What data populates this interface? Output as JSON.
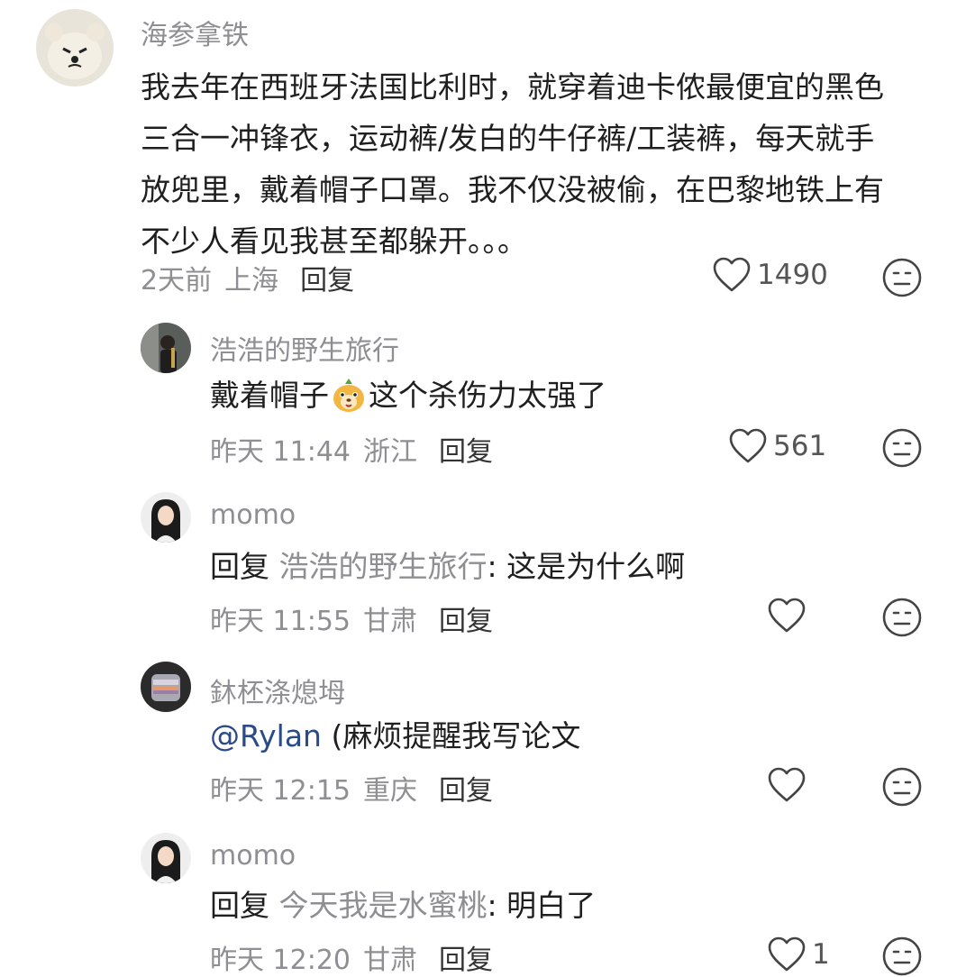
{
  "comments": [
    {
      "username": "海参拿铁",
      "text_lines": [
        "我去年在西班牙法国比利时，就穿着迪卡侬最便宜的黑色",
        "三合一冲锋衣，运动裤/发白的牛仔裤/工装裤，每天就手",
        "放兜里，戴着帽子口罩。我不仅没被偷，在巴黎地铁上有",
        "不少人看见我甚至都躲开。。。"
      ],
      "time": "2天前",
      "location": "上海",
      "reply_label": "回复",
      "likes": "1490"
    },
    {
      "username": "浩浩的野生旅行",
      "text_before": "戴着帽子",
      "text_after": "这个杀伤力太强了",
      "time": "昨天 11:44",
      "location": "浙江",
      "reply_label": "回复",
      "likes": "561"
    },
    {
      "username": "momo",
      "reply_prefix": "回复",
      "reply_target": "浩浩的野生旅行",
      "text": ": 这是为什么啊",
      "time": "昨天 11:55",
      "location": "甘肃",
      "reply_label": "回复",
      "likes": ""
    },
    {
      "username": "鈢柸涤熄坶",
      "mention": "@Rylan",
      "text": " (麻烦提醒我写论文",
      "time": "昨天 12:15",
      "location": "重庆",
      "reply_label": "回复",
      "likes": ""
    },
    {
      "username": "momo",
      "reply_prefix": "回复",
      "reply_target": "今天我是水蜜桃",
      "text": ": 明白了",
      "time": "昨天 12:20",
      "location": "甘肃",
      "reply_label": "回复",
      "likes": "1"
    }
  ],
  "icons": {
    "like": "heart-outline-icon",
    "dislike": "meh-face-icon"
  },
  "colors": {
    "meta": "#8e8e93",
    "text": "#1f1f1f",
    "mention": "#2b4a8a"
  }
}
